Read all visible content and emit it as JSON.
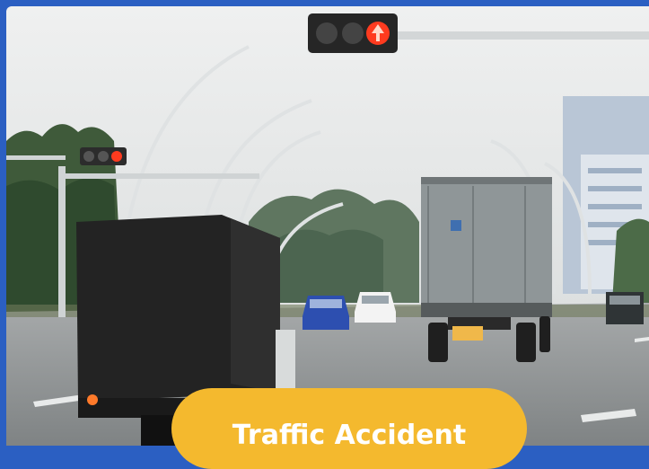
{
  "scene": {
    "subject": "street-with-traffic-lights-and-trucks",
    "icon": "traffic-scene"
  },
  "badge": {
    "label": "Traffic Accident"
  },
  "colors": {
    "frame": "#2b5fc2",
    "badge": "#f4b92e",
    "badge_text": "#ffffff",
    "sky": "#e9ebec",
    "road": "#8d9192",
    "signal_red": "#ff3b1f"
  }
}
